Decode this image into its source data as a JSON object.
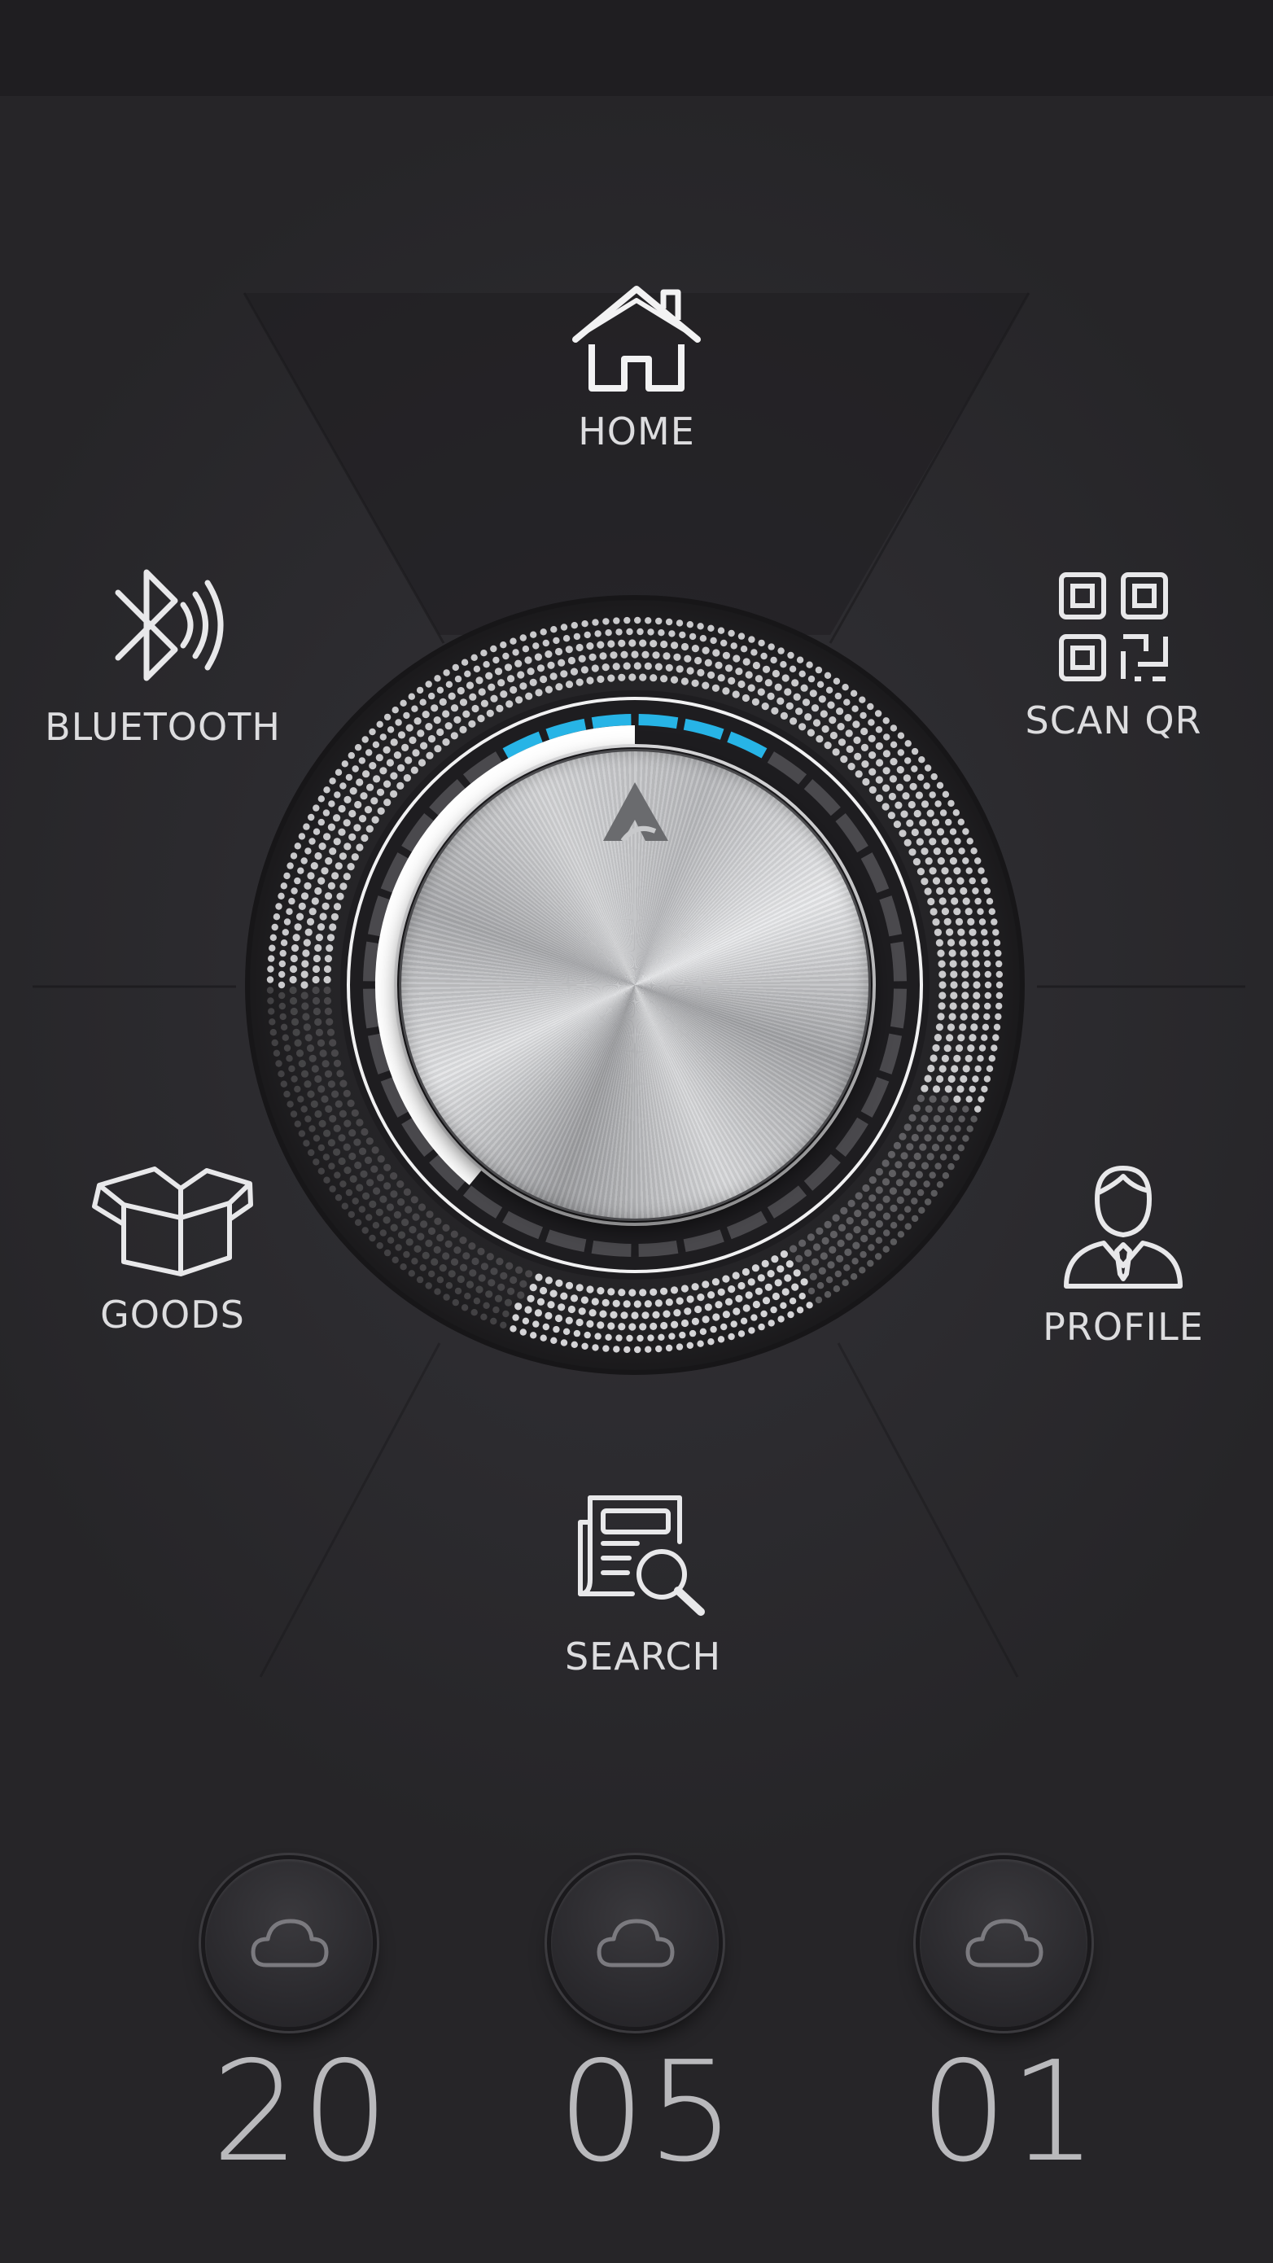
{
  "nav": {
    "home": "HOME",
    "bluetooth": "BLUETOOTH",
    "scan_qr": "SCAN QR",
    "goods": "GOODS",
    "profile": "PROFILE",
    "search": "SEARCH"
  },
  "icons": {
    "home": "home-icon",
    "bluetooth": "bluetooth-icon",
    "scan_qr": "qr-code-icon",
    "goods": "box-icon",
    "profile": "user-icon",
    "search": "document-search-icon",
    "knob_logo": "logo-icon",
    "cloud": "cloud-icon"
  },
  "dial": {
    "level_fraction": 0.3,
    "accent_color": "#27b4e6",
    "track_color": "#ffffff"
  },
  "counters": [
    {
      "value": "20",
      "icon": "cloud-icon"
    },
    {
      "value": "05",
      "icon": "cloud-icon"
    },
    {
      "value": "01",
      "icon": "cloud-icon"
    }
  ],
  "colors": {
    "background": "#2c2b2f",
    "text": "#dddddf",
    "digits": "#b9b9bc",
    "accent": "#27b4e6"
  }
}
